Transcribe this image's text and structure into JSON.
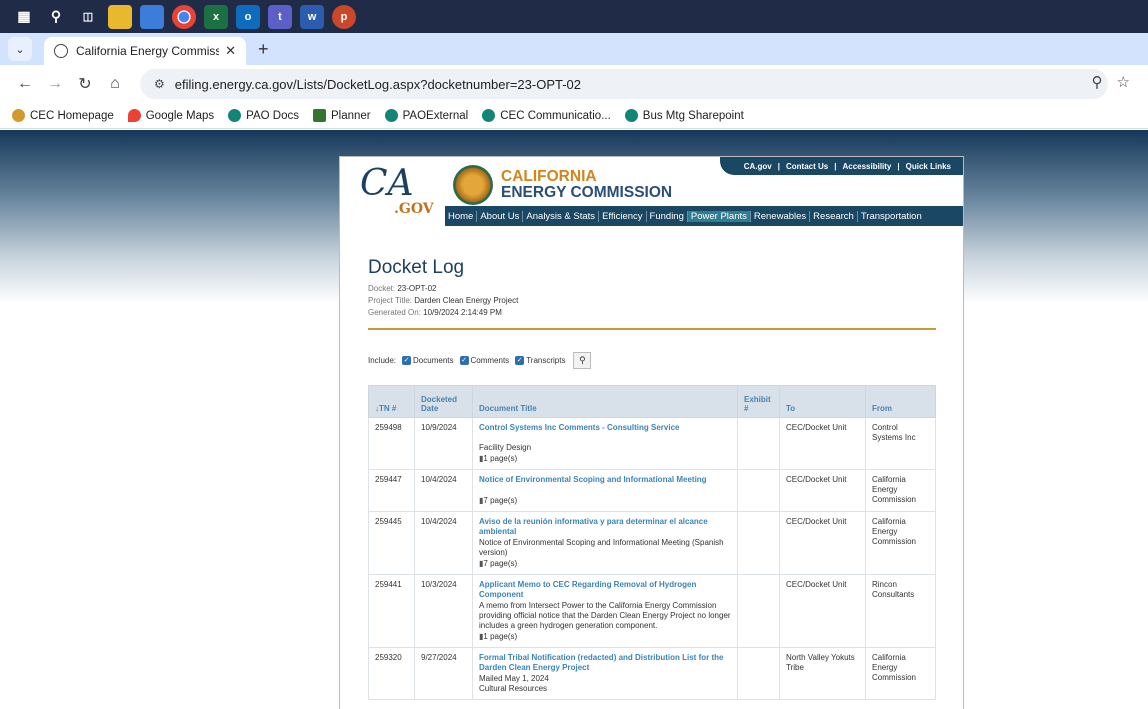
{
  "taskbar": {
    "icons": [
      "windows-icon",
      "search-icon",
      "task-view-icon",
      "file-explorer-icon",
      "app-icon",
      "chrome-icon",
      "excel-icon",
      "outlook-icon",
      "teams-icon",
      "word-icon",
      "powerpoint-icon"
    ]
  },
  "browser": {
    "tab_title": "California Energy Commission :",
    "url": "efiling.energy.ca.gov/Lists/DocketLog.aspx?docketnumber=23-OPT-02",
    "bookmarks": [
      "CEC Homepage",
      "Google Maps",
      "PAO Docs",
      "Planner",
      "PAOExternal",
      "CEC Communicatio...",
      "Bus Mtg Sharepoint"
    ]
  },
  "site": {
    "logo_text": "CA",
    "logo_sub": ".GOV",
    "org_line1": "CALIFORNIA",
    "org_line2": "ENERGY COMMISSION",
    "utility_links": [
      "CA.gov",
      "|",
      "Contact Us",
      "|",
      "Accessibility",
      "|",
      "Quick Links"
    ],
    "nav": [
      "Home",
      "About Us",
      "Analysis & Stats",
      "Efficiency",
      "Funding",
      "Power Plants",
      "Renewables",
      "Research",
      "Transportation"
    ]
  },
  "docket": {
    "title": "Docket Log",
    "docket_label": "Docket:",
    "docket_value": "23-OPT-02",
    "project_label": "Project Title:",
    "project_value": "Darden Clean Energy Project",
    "generated_label": "Generated On:",
    "generated_value": "10/9/2024 2:14:49 PM",
    "include_label": "Include:",
    "filters": [
      "Documents",
      "Comments",
      "Transcripts"
    ]
  },
  "table": {
    "headers": {
      "tn": "↓TN #",
      "date": "Docketed Date",
      "title": "Document Title",
      "exhibit": "Exhibit #",
      "to": "To",
      "from": "From"
    },
    "rows": [
      {
        "tn": "259498",
        "date": "10/9/2024",
        "title": "Control Systems Inc Comments - Consulting Service",
        "desc": "Facility Design",
        "pages": "1 page(s)",
        "to": "CEC/Docket Unit",
        "from": "Control Systems Inc"
      },
      {
        "tn": "259447",
        "date": "10/4/2024",
        "title": "Notice of Environmental Scoping and Informational Meeting",
        "desc": "",
        "pages": "7 page(s)",
        "to": "CEC/Docket Unit",
        "from": "California Energy Commission"
      },
      {
        "tn": "259445",
        "date": "10/4/2024",
        "title": "Aviso de la reunión informativa y para determinar el alcance ambiental",
        "desc": "Notice of Environmental Scoping and Informational Meeting (Spanish version)",
        "pages": "7 page(s)",
        "to": "CEC/Docket Unit",
        "from": "California Energy Commission"
      },
      {
        "tn": "259441",
        "date": "10/3/2024",
        "title": "Applicant Memo to CEC Regarding Removal of Hydrogen Component",
        "desc": "A memo from Intersect Power to the California Energy Commission providing official notice that the Darden Clean Energy Project no longer includes a green hydrogen generation component.",
        "pages": "1 page(s)",
        "to": "CEC/Docket Unit",
        "from": "Rincon Consultants"
      },
      {
        "tn": "259320",
        "date": "9/27/2024",
        "title": "Formal Tribal Notification (redacted) and Distribution List for the Darden Clean Energy Project",
        "desc": "Mailed May 1, 2024",
        "desc2": "Cultural Resources",
        "pages": "",
        "to": "North Valley Yokuts Tribe",
        "from": "California Energy Commission"
      }
    ]
  }
}
